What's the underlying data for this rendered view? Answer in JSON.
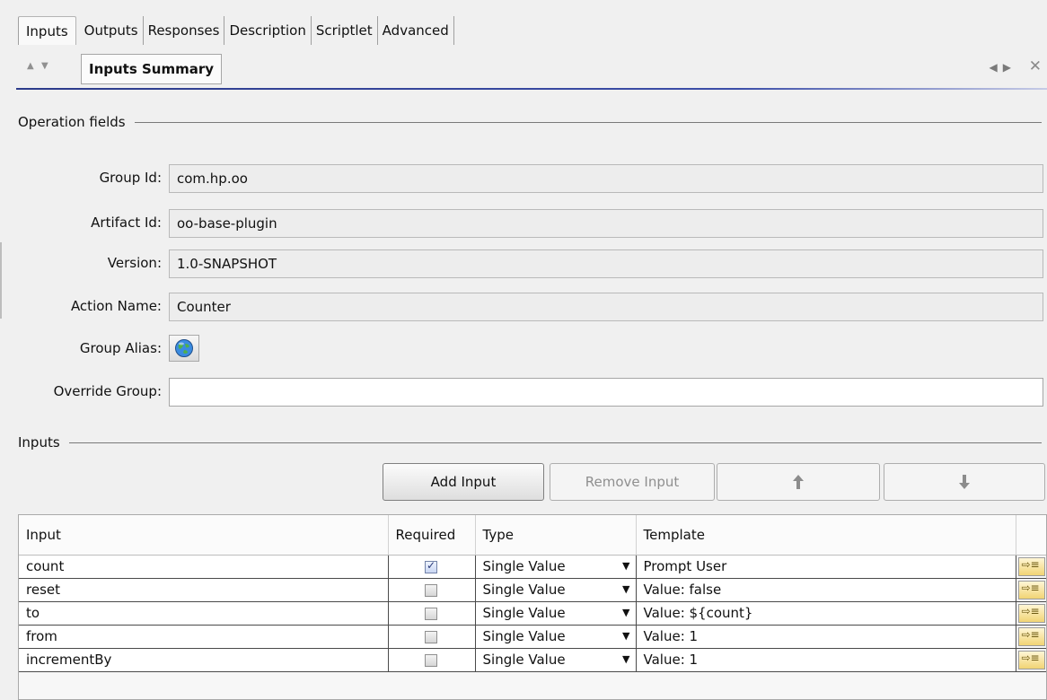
{
  "tabs": [
    {
      "label": "Inputs",
      "active": true
    },
    {
      "label": "Outputs"
    },
    {
      "label": "Responses"
    },
    {
      "label": "Description"
    },
    {
      "label": "Scriptlet"
    },
    {
      "label": "Advanced"
    }
  ],
  "editor": {
    "title": "Inputs Summary"
  },
  "operation": {
    "section_title": "Operation fields",
    "group_id_label": "Group Id:",
    "group_id_value": "com.hp.oo",
    "artifact_id_label": "Artifact Id:",
    "artifact_id_value": "oo-base-plugin",
    "version_label": "Version:",
    "version_value": "1.0-SNAPSHOT",
    "action_name_label": "Action Name:",
    "action_name_value": "Counter",
    "group_alias_label": "Group Alias:",
    "override_group_label": "Override Group:",
    "override_group_value": ""
  },
  "inputs": {
    "section_title": "Inputs",
    "add_label": "Add Input",
    "remove_label": "Remove Input",
    "columns": [
      "Input",
      "Required",
      "Type",
      "Template"
    ],
    "rows": [
      {
        "input": "count",
        "required": true,
        "type": "Single Value",
        "template": "Prompt User"
      },
      {
        "input": "reset",
        "required": false,
        "type": "Single Value",
        "template": "Value: false"
      },
      {
        "input": "to",
        "required": false,
        "type": "Single Value",
        "template": "Value: ${count}"
      },
      {
        "input": "from",
        "required": false,
        "type": "Single Value",
        "template": "Value: 1"
      },
      {
        "input": "incrementBy",
        "required": false,
        "type": "Single Value",
        "template": "Value: 1"
      }
    ]
  },
  "icons": {
    "move_up": "arrow-up-icon",
    "move_down": "arrow-down-icon",
    "template_edit": "template-edit-icon",
    "globe": "globe-icon"
  },
  "colors": {
    "accent": "#2c3b8a",
    "header_bg": "#f0f0f0"
  }
}
